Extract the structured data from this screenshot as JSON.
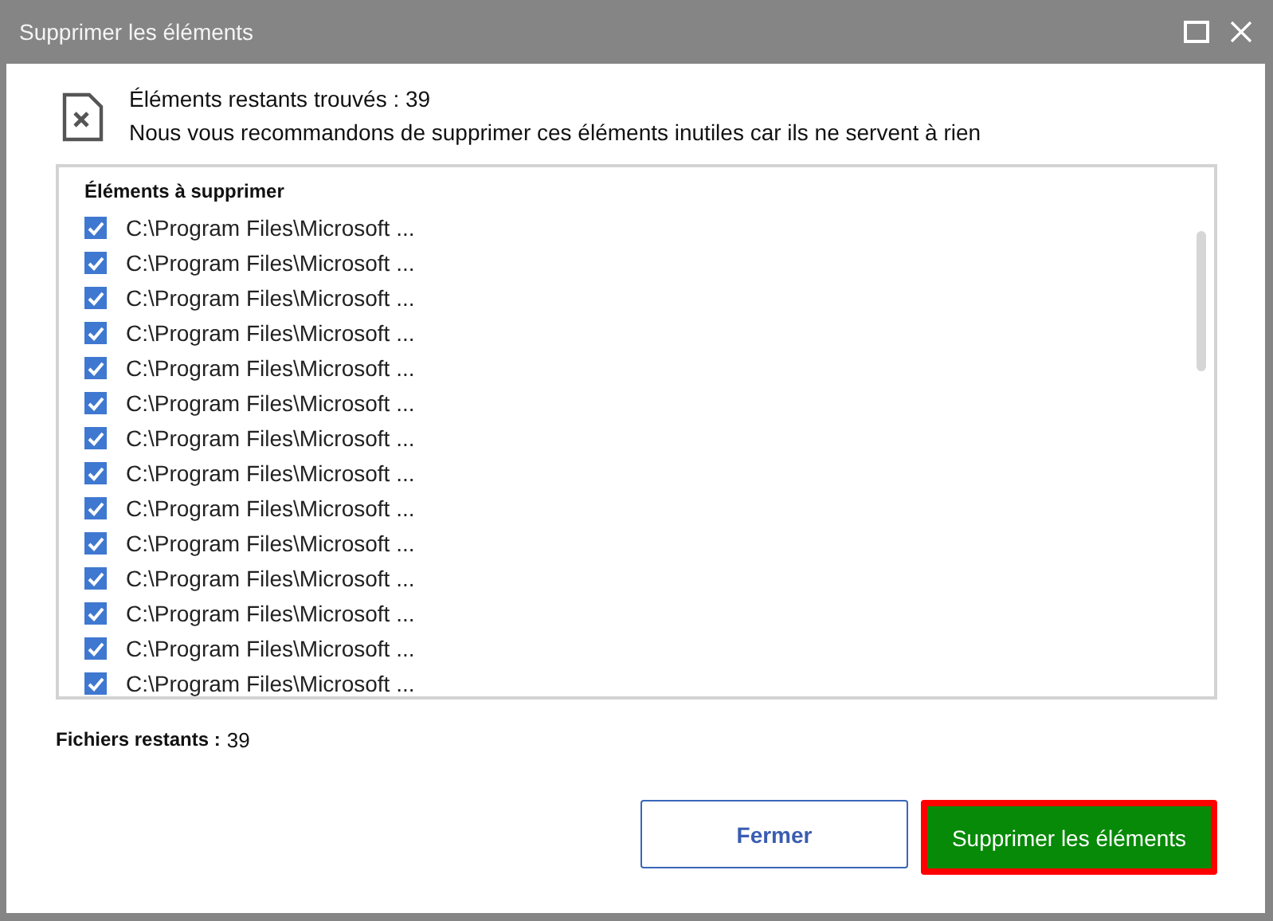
{
  "window": {
    "title": "Supprimer les éléments"
  },
  "header": {
    "title": "Éléments restants trouvés : 39",
    "message": "Nous vous recommandons de supprimer ces éléments inutiles car ils ne servent à rien"
  },
  "list": {
    "heading": "Éléments à supprimer",
    "items": [
      {
        "path": "C:\\Program Files\\Microsoft ...",
        "checked": true
      },
      {
        "path": "C:\\Program Files\\Microsoft ...",
        "checked": true
      },
      {
        "path": "C:\\Program Files\\Microsoft ...",
        "checked": true
      },
      {
        "path": "C:\\Program Files\\Microsoft ...",
        "checked": true
      },
      {
        "path": "C:\\Program Files\\Microsoft ...",
        "checked": true
      },
      {
        "path": "C:\\Program Files\\Microsoft ...",
        "checked": true
      },
      {
        "path": "C:\\Program Files\\Microsoft ...",
        "checked": true
      },
      {
        "path": "C:\\Program Files\\Microsoft ...",
        "checked": true
      },
      {
        "path": "C:\\Program Files\\Microsoft ...",
        "checked": true
      },
      {
        "path": "C:\\Program Files\\Microsoft ...",
        "checked": true
      },
      {
        "path": "C:\\Program Files\\Microsoft ...",
        "checked": true
      },
      {
        "path": "C:\\Program Files\\Microsoft ...",
        "checked": true
      },
      {
        "path": "C:\\Program Files\\Microsoft ...",
        "checked": true
      },
      {
        "path": "C:\\Program Files\\Microsoft ...",
        "checked": true
      }
    ]
  },
  "summary": {
    "label": "Fichiers restants :",
    "value": "39"
  },
  "buttons": [
    {
      "label": "Fermer",
      "kind": "secondary"
    },
    {
      "label": "Supprimer les éléments",
      "kind": "primary"
    }
  ]
}
